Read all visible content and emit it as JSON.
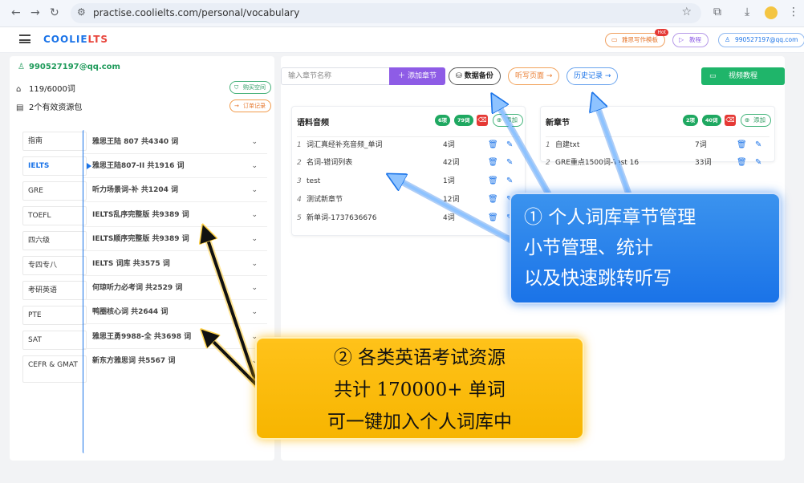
{
  "browser": {
    "url": "practise.coolielts.com/personal/vocabulary"
  },
  "header": {
    "logo_main": "COOLIE",
    "logo_accent": "LTS",
    "writing_template": "雅思写作模板",
    "hot_badge": "Hot",
    "tutorial": "教程",
    "account": "990527197@qq.com"
  },
  "sidebar": {
    "email": "990527197@qq.com",
    "word_quota": "119/6000词",
    "resource_packs": "2个有效资源包",
    "buy_space": "购买空间",
    "order_history": "订单记录",
    "categories": [
      {
        "label": "指南"
      },
      {
        "label": "IELTS"
      },
      {
        "label": "GRE"
      },
      {
        "label": "TOEFL"
      },
      {
        "label": "四六级"
      },
      {
        "label": "专四专八"
      },
      {
        "label": "考研英语"
      },
      {
        "label": "PTE"
      },
      {
        "label": "SAT"
      },
      {
        "label": "CEFR & GMAT"
      }
    ],
    "books": [
      {
        "label": "雅思王陆 807 共4340 词"
      },
      {
        "label": "雅思王陆807-II 共1916 词"
      },
      {
        "label": "听力场景词-补 共1204 词"
      },
      {
        "label": "IELTS乱序完整版 共9389 词"
      },
      {
        "label": "IELTS顺序完整版 共9389 词"
      },
      {
        "label": "IELTS 词库 共3575 词"
      },
      {
        "label": "何琼听力必考词 共2529 词"
      },
      {
        "label": "鸭圈核心词 共2644 词"
      },
      {
        "label": "雅思王勇9988-全 共3698 词"
      },
      {
        "label": "新东方雅思词 共5567 词"
      }
    ]
  },
  "toolbar": {
    "search_placeholder": "输入章节名称",
    "add_chapter": "添加章节",
    "backup": "数据备份",
    "dictation": "听写页面",
    "history": "历史记录",
    "video": "视频教程"
  },
  "chapters": [
    {
      "title": "语料音频",
      "sections_badge": "6项",
      "words_badge": "79词",
      "add": "添加",
      "rows": [
        {
          "idx": "1",
          "name": "词汇真经补充音频_单词",
          "count": "4词"
        },
        {
          "idx": "2",
          "name": "名词-错词列表",
          "count": "42词"
        },
        {
          "idx": "3",
          "name": "test",
          "count": "1词"
        },
        {
          "idx": "4",
          "name": "测试新章节",
          "count": "12词"
        },
        {
          "idx": "5",
          "name": "新单词-1737636676",
          "count": "4词"
        }
      ]
    },
    {
      "title": "新章节",
      "sections_badge": "2项",
      "words_badge": "40词",
      "add": "添加",
      "rows": [
        {
          "idx": "1",
          "name": "自建txt",
          "count": "7词"
        },
        {
          "idx": "2",
          "name": "GRE重点1500词-Test 16",
          "count": "33词"
        }
      ]
    }
  ],
  "annotations": {
    "blue": [
      "① 个人词库章节管理",
      "小节管理、统计",
      "以及快速跳转听写"
    ],
    "yellow": [
      "② 各类英语考试资源",
      "共计 170000+ 单词",
      "可一键加入个人词库中"
    ]
  },
  "colors": {
    "brand_blue": "#1a73e8",
    "brand_red": "#e8453c",
    "purple": "#8e5ce6",
    "green": "#1fb56a",
    "callout_blue": "#1a73e8",
    "callout_yellow": "#f7b500"
  }
}
